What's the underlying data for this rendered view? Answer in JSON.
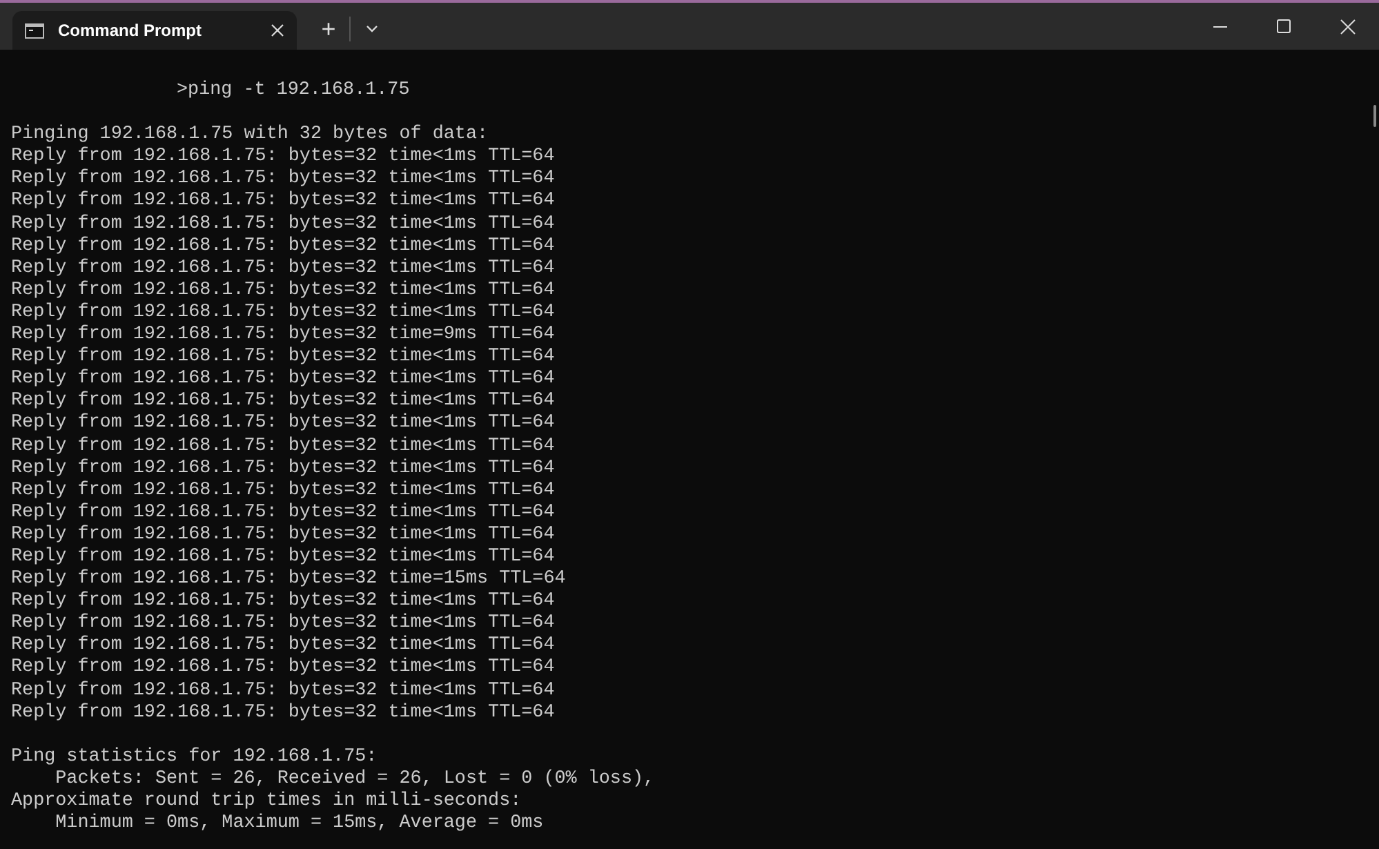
{
  "window": {
    "title": "Command Prompt"
  },
  "tab_bar": {
    "new_tab": "+"
  },
  "terminal": {
    "command": ">ping -t 192.168.1.75",
    "blocks": [
      {
        "lines": [
          "Pinging 192.168.1.75 with 32 bytes of data:",
          "Reply from 192.168.1.75: bytes=32 time<1ms TTL=64",
          "Reply from 192.168.1.75: bytes=32 time<1ms TTL=64",
          "Reply from 192.168.1.75: bytes=32 time<1ms TTL=64",
          "Reply from 192.168.1.75: bytes=32 time<1ms TTL=64",
          "Reply from 192.168.1.75: bytes=32 time<1ms TTL=64",
          "Reply from 192.168.1.75: bytes=32 time<1ms TTL=64",
          "Reply from 192.168.1.75: bytes=32 time<1ms TTL=64",
          "Reply from 192.168.1.75: bytes=32 time<1ms TTL=64",
          "Reply from 192.168.1.75: bytes=32 time=9ms TTL=64",
          "Reply from 192.168.1.75: bytes=32 time<1ms TTL=64",
          "Reply from 192.168.1.75: bytes=32 time<1ms TTL=64",
          "Reply from 192.168.1.75: bytes=32 time<1ms TTL=64",
          "Reply from 192.168.1.75: bytes=32 time<1ms TTL=64",
          "Reply from 192.168.1.75: bytes=32 time<1ms TTL=64",
          "Reply from 192.168.1.75: bytes=32 time<1ms TTL=64",
          "Reply from 192.168.1.75: bytes=32 time<1ms TTL=64",
          "Reply from 192.168.1.75: bytes=32 time<1ms TTL=64",
          "Reply from 192.168.1.75: bytes=32 time<1ms TTL=64",
          "Reply from 192.168.1.75: bytes=32 time<1ms TTL=64",
          "Reply from 192.168.1.75: bytes=32 time=15ms TTL=64",
          "Reply from 192.168.1.75: bytes=32 time<1ms TTL=64",
          "Reply from 192.168.1.75: bytes=32 time<1ms TTL=64",
          "Reply from 192.168.1.75: bytes=32 time<1ms TTL=64",
          "Reply from 192.168.1.75: bytes=32 time<1ms TTL=64",
          "Reply from 192.168.1.75: bytes=32 time<1ms TTL=64",
          "Reply from 192.168.1.75: bytes=32 time<1ms TTL=64"
        ]
      },
      {
        "lines": [
          "Ping statistics for 192.168.1.75:",
          "    Packets: Sent = 26, Received = 26, Lost = 0 (0% loss),",
          "Approximate round trip times in milli-seconds:",
          "    Minimum = 0ms, Maximum = 15ms, Average = 0ms"
        ]
      }
    ]
  }
}
